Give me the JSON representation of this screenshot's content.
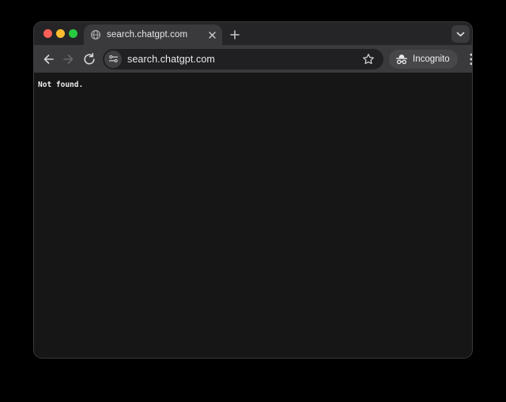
{
  "window": {
    "controls": {
      "close_color": "#ff5f57",
      "minimize_color": "#febc2e",
      "zoom_color": "#28c840"
    }
  },
  "tabstrip": {
    "active_tab": {
      "title": "search.chatgpt.com",
      "favicon": "globe-icon"
    }
  },
  "toolbar": {
    "url": "search.chatgpt.com",
    "incognito_badge": {
      "label": "Incognito",
      "icon": "incognito-icon"
    }
  },
  "page": {
    "body_text": "Not found."
  },
  "colors": {
    "frame": "#252527",
    "active_tab": "#3a3a3d",
    "toolbar": "#3a3a3d",
    "omnibox": "#202023",
    "content_background": "#161616",
    "text": "#ececec"
  }
}
